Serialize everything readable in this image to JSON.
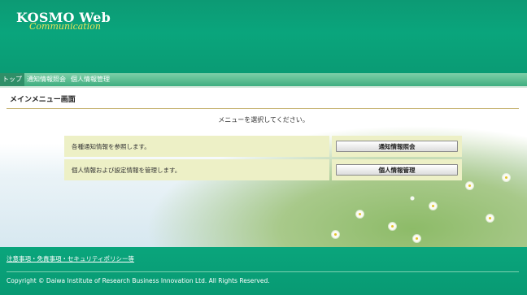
{
  "header": {
    "logo_main": "KOSMO Web",
    "logo_sub": "Communication"
  },
  "nav": {
    "items": [
      {
        "label": "トップ",
        "active": true
      },
      {
        "label": "通知情報照会",
        "active": false
      },
      {
        "label": "個人情報管理",
        "active": false
      }
    ]
  },
  "main": {
    "title": "メインメニュー画面",
    "instruction": "メニューを選択してください。",
    "menu": [
      {
        "description": "各種通知情報を参照します。",
        "button": "通知情報照会"
      },
      {
        "description": "個人情報および設定情報を管理します。",
        "button": "個人情報管理"
      }
    ]
  },
  "footer": {
    "link": "注意事項・免責事項・セキュリティポリシー等",
    "copyright": "Copyright © Daiwa Institute of Research Business Innovation Ltd. All Rights Reserved."
  }
}
